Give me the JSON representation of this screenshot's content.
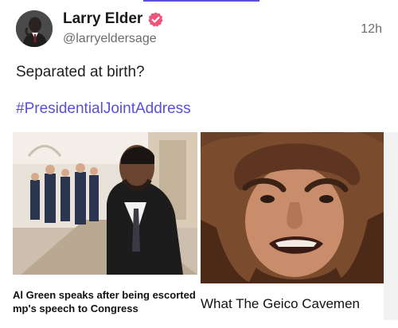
{
  "post": {
    "author_name": "Larry Elder",
    "author_handle": "@larryeldersage",
    "timestamp": "12h",
    "text": "Separated at birth?",
    "hashtag": "#PresidentialJointAddress"
  },
  "media": [
    {
      "caption_line1": "Al Green speaks after being escorted",
      "caption_line2": "mp's speech to Congress"
    },
    {
      "caption": "What The Geico Cavemen"
    }
  ],
  "colors": {
    "accent": "#5b4fd6",
    "verified_badge": "#f0547a"
  }
}
